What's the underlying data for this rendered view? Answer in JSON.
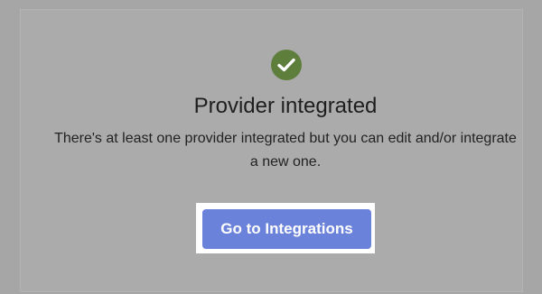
{
  "status": {
    "icon": "check-circle-icon",
    "icon_color": "#5e7e3b",
    "title": "Provider integrated",
    "description": "There's at least one provider integrated but you can edit and/or integrate a new one."
  },
  "actions": {
    "primary_label": "Go to Integrations",
    "primary_color": "#6a82d9"
  }
}
